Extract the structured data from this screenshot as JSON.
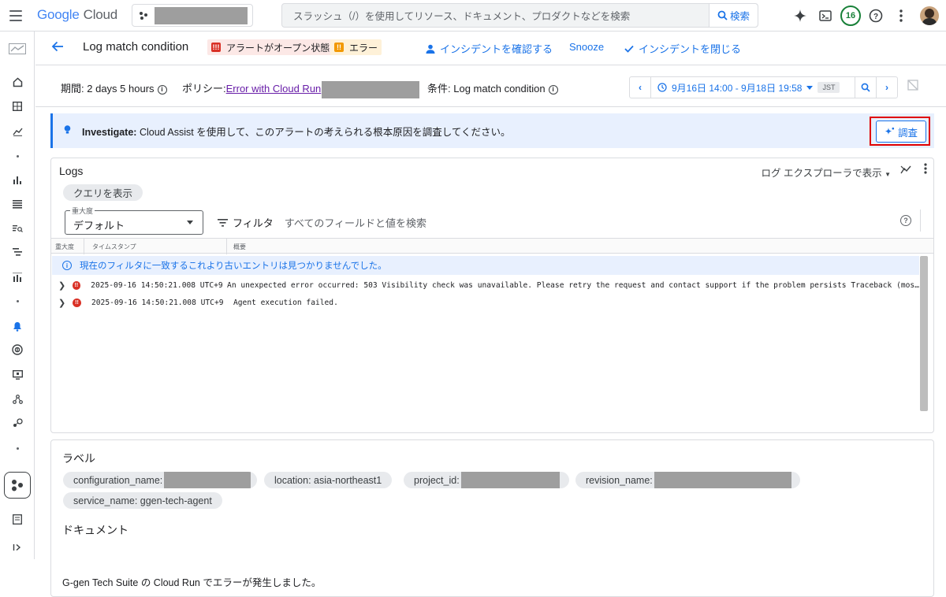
{
  "topbar": {
    "logo_google": "Google",
    "logo_cloud": "Cloud",
    "search_placeholder": "スラッシュ（/）を使用してリソース、ドキュメント、プロダクトなどを検索",
    "search_button": "検索",
    "notifications_count": "16"
  },
  "sidenav": {
    "items": [
      "dashboard-icon",
      "home-icon",
      "grid-icon",
      "chart-icon",
      "bar-chart-icon",
      "list-icon",
      "log-search-icon",
      "trace-icon",
      "metrics-icon",
      "alert-bell-icon",
      "monitoring-icon",
      "display-icon",
      "nodes-icon",
      "dependencies-icon",
      "cloud-run-icon",
      "notes-icon",
      "expand-icon"
    ]
  },
  "header": {
    "title": "Log match condition",
    "chip_alert_open": "アラートがオープン状態",
    "chip_error": "エラー",
    "action_ack": "インシデントを確認する",
    "action_snooze": "Snooze",
    "action_close": "インシデントを閉じる"
  },
  "filters": {
    "period_label": "期間:",
    "period_value": "2 days 5 hours",
    "policy_label": "ポリシー:",
    "policy_value": "Error with Cloud Run",
    "condition_label": "条件:",
    "condition_value": "Log match condition",
    "time_range": "9月16日 14:00 - 9月18日 19:58",
    "timezone": "JST"
  },
  "investigate": {
    "title": "Investigate:",
    "message": "Cloud Assist を使用して、このアラートの考えられる根本原因を調査してください。",
    "button": "調査"
  },
  "logs": {
    "title": "Logs",
    "view_in_explorer": "ログ エクスプローラで表示",
    "query_chip": "クエリを表示",
    "severity_label": "重大度",
    "severity_value": "デフォルト",
    "filter_label": "フィルタ",
    "filter_placeholder": "すべてのフィールドと値を検索",
    "columns": [
      "重大度",
      "タイムスタンプ",
      "概要"
    ],
    "notice": "現在のフィルタに一致するこれより古いエントリは見つかりませんでした。",
    "rows": [
      {
        "timestamp": "2025-09-16 14:50:21.008 UTC+9",
        "summary": "An unexpected error occurred: 503 Visibility check was unavailable. Please retry the request and contact support if the problem persists Traceback (mos…"
      },
      {
        "timestamp": "2025-09-16 14:50:21.008 UTC+9",
        "summary": "Agent execution failed."
      }
    ]
  },
  "labels_section": {
    "title": "ラベル",
    "chips": [
      {
        "key": "configuration_name:",
        "value": ""
      },
      {
        "key": "location: asia-northeast1",
        "value": ""
      },
      {
        "key": "project_id:",
        "value": ""
      },
      {
        "key": "revision_name:",
        "value": ""
      },
      {
        "key": "service_name: ggen-tech-agent",
        "value": ""
      }
    ],
    "doc_title": "ドキュメント",
    "doc_text": "G-gen Tech Suite の Cloud Run でエラーが発生しました。"
  },
  "colors": {
    "accent": "#1a73e8",
    "error": "#d93025",
    "warning": "#f29900",
    "highlight": "#e00000"
  }
}
